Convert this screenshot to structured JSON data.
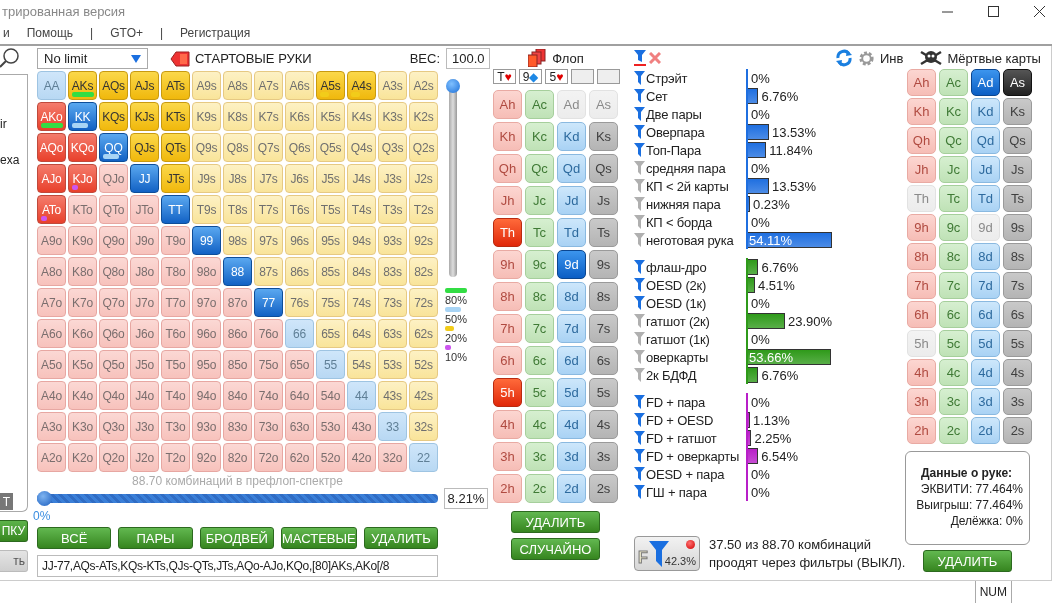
{
  "window": {
    "title": "трированная версия"
  },
  "menu": [
    "и",
    "Помощь",
    "|",
    "GTO+",
    "|",
    "Регистрация"
  ],
  "left_panel": {
    "texts": [
      "ir",
      "exa"
    ],
    "tag": "T",
    "buttons": [
      {
        "label": "ПКУ",
        "disabled": false
      },
      {
        "label": "ть",
        "disabled": true
      }
    ]
  },
  "range": {
    "game_type": "No limit",
    "title": "СТАРТОВЫЕ РУКИ",
    "weight_label": "ВЕС:",
    "weight_value": "100.0",
    "weight_slider": {
      "level": 1
    },
    "legend": [
      {
        "label": "80%",
        "color": "#33dd44"
      },
      {
        "label": "50%",
        "color": "#a8d4f5"
      },
      {
        "label": "20%",
        "color": "#f2cc1a"
      },
      {
        "label": "10%",
        "color": "#cc55ee"
      }
    ],
    "grid": [
      [
        {
          "label": "AA",
          "selected": false
        },
        {
          "label": "AKs",
          "selected": true,
          "color": "#33dd44"
        },
        {
          "label": "AQs",
          "selected": true
        },
        {
          "label": "AJs",
          "selected": true
        },
        {
          "label": "ATs",
          "selected": true
        },
        {
          "label": "A9s",
          "selected": false
        },
        {
          "label": "A8s",
          "selected": false
        },
        {
          "label": "A7s",
          "selected": false
        },
        {
          "label": "A6s",
          "selected": false
        },
        {
          "label": "A5s",
          "selected": true,
          "color": "#f2cc1a"
        },
        {
          "label": "A4s",
          "selected": true,
          "color": "#f2cc1a"
        },
        {
          "label": "A3s",
          "selected": false
        },
        {
          "label": "A2s",
          "selected": false
        }
      ],
      [
        {
          "label": "AKo",
          "selected": true,
          "color": "#33dd44"
        },
        {
          "label": "KK",
          "selected": true,
          "color": "#a8d4f5"
        },
        {
          "label": "KQs",
          "selected": true
        },
        {
          "label": "KJs",
          "selected": true
        },
        {
          "label": "KTs",
          "selected": true
        },
        {
          "label": "K9s",
          "selected": false
        },
        {
          "label": "K8s",
          "selected": false
        },
        {
          "label": "K7s",
          "selected": false
        },
        {
          "label": "K6s",
          "selected": false
        },
        {
          "label": "K5s",
          "selected": false
        },
        {
          "label": "K4s",
          "selected": false
        },
        {
          "label": "K3s",
          "selected": false
        },
        {
          "label": "K2s",
          "selected": false
        }
      ],
      [
        {
          "label": "AQo",
          "selected": true
        },
        {
          "label": "KQo",
          "selected": true
        },
        {
          "label": "QQ",
          "selected": true,
          "color": "#a8d4f5"
        },
        {
          "label": "QJs",
          "selected": true
        },
        {
          "label": "QTs",
          "selected": true
        },
        {
          "label": "Q9s",
          "selected": false
        },
        {
          "label": "Q8s",
          "selected": false
        },
        {
          "label": "Q7s",
          "selected": false
        },
        {
          "label": "Q6s",
          "selected": false
        },
        {
          "label": "Q5s",
          "selected": false
        },
        {
          "label": "Q4s",
          "selected": false
        },
        {
          "label": "Q3s",
          "selected": false
        },
        {
          "label": "Q2s",
          "selected": false
        }
      ],
      [
        {
          "label": "AJo",
          "selected": true
        },
        {
          "label": "KJo",
          "selected": true,
          "color": "#cc55ee"
        },
        {
          "label": "QJo",
          "selected": false
        },
        {
          "label": "JJ",
          "selected": true
        },
        {
          "label": "JTs",
          "selected": true
        },
        {
          "label": "J9s",
          "selected": false
        },
        {
          "label": "J8s",
          "selected": false
        },
        {
          "label": "J7s",
          "selected": false
        },
        {
          "label": "J6s",
          "selected": false
        },
        {
          "label": "J5s",
          "selected": false
        },
        {
          "label": "J4s",
          "selected": false
        },
        {
          "label": "J3s",
          "selected": false
        },
        {
          "label": "J2s",
          "selected": false
        }
      ],
      [
        {
          "label": "ATo",
          "selected": true,
          "color": "#cc55ee"
        },
        {
          "label": "KTo",
          "selected": false
        },
        {
          "label": "QTo",
          "selected": false
        },
        {
          "label": "JTo",
          "selected": false
        },
        {
          "label": "TT",
          "selected": true
        },
        {
          "label": "T9s",
          "selected": false
        },
        {
          "label": "T8s",
          "selected": false
        },
        {
          "label": "T7s",
          "selected": false
        },
        {
          "label": "T6s",
          "selected": false
        },
        {
          "label": "T5s",
          "selected": false
        },
        {
          "label": "T4s",
          "selected": false
        },
        {
          "label": "T3s",
          "selected": false
        },
        {
          "label": "T2s",
          "selected": false
        }
      ],
      [
        {
          "label": "A9o",
          "selected": false
        },
        {
          "label": "K9o",
          "selected": false
        },
        {
          "label": "Q9o",
          "selected": false
        },
        {
          "label": "J9o",
          "selected": false
        },
        {
          "label": "T9o",
          "selected": false
        },
        {
          "label": "99",
          "selected": true
        },
        {
          "label": "98s",
          "selected": false
        },
        {
          "label": "97s",
          "selected": false
        },
        {
          "label": "96s",
          "selected": false
        },
        {
          "label": "95s",
          "selected": false
        },
        {
          "label": "94s",
          "selected": false
        },
        {
          "label": "93s",
          "selected": false
        },
        {
          "label": "92s",
          "selected": false
        }
      ],
      [
        {
          "label": "A8o",
          "selected": false
        },
        {
          "label": "K8o",
          "selected": false
        },
        {
          "label": "Q8o",
          "selected": false
        },
        {
          "label": "J8o",
          "selected": false
        },
        {
          "label": "T8o",
          "selected": false
        },
        {
          "label": "98o",
          "selected": false
        },
        {
          "label": "88",
          "selected": true
        },
        {
          "label": "87s",
          "selected": false
        },
        {
          "label": "86s",
          "selected": false
        },
        {
          "label": "85s",
          "selected": false
        },
        {
          "label": "84s",
          "selected": false
        },
        {
          "label": "83s",
          "selected": false
        },
        {
          "label": "82s",
          "selected": false
        }
      ],
      [
        {
          "label": "A7o",
          "selected": false
        },
        {
          "label": "K7o",
          "selected": false
        },
        {
          "label": "Q7o",
          "selected": false
        },
        {
          "label": "J7o",
          "selected": false
        },
        {
          "label": "T7o",
          "selected": false
        },
        {
          "label": "97o",
          "selected": false
        },
        {
          "label": "87o",
          "selected": false
        },
        {
          "label": "77",
          "selected": true
        },
        {
          "label": "76s",
          "selected": false
        },
        {
          "label": "75s",
          "selected": false
        },
        {
          "label": "74s",
          "selected": false
        },
        {
          "label": "73s",
          "selected": false
        },
        {
          "label": "72s",
          "selected": false
        }
      ],
      [
        {
          "label": "A6o",
          "selected": false
        },
        {
          "label": "K6o",
          "selected": false
        },
        {
          "label": "Q6o",
          "selected": false
        },
        {
          "label": "J6o",
          "selected": false
        },
        {
          "label": "T6o",
          "selected": false
        },
        {
          "label": "96o",
          "selected": false
        },
        {
          "label": "86o",
          "selected": false
        },
        {
          "label": "76o",
          "selected": false
        },
        {
          "label": "66",
          "selected": false
        },
        {
          "label": "65s",
          "selected": false
        },
        {
          "label": "64s",
          "selected": false
        },
        {
          "label": "63s",
          "selected": false
        },
        {
          "label": "62s",
          "selected": false
        }
      ],
      [
        {
          "label": "A5o",
          "selected": false
        },
        {
          "label": "K5o",
          "selected": false
        },
        {
          "label": "Q5o",
          "selected": false
        },
        {
          "label": "J5o",
          "selected": false
        },
        {
          "label": "T5o",
          "selected": false
        },
        {
          "label": "95o",
          "selected": false
        },
        {
          "label": "85o",
          "selected": false
        },
        {
          "label": "75o",
          "selected": false
        },
        {
          "label": "65o",
          "selected": false
        },
        {
          "label": "55",
          "selected": false
        },
        {
          "label": "54s",
          "selected": false
        },
        {
          "label": "53s",
          "selected": false
        },
        {
          "label": "52s",
          "selected": false
        }
      ],
      [
        {
          "label": "A4o",
          "selected": false
        },
        {
          "label": "K4o",
          "selected": false
        },
        {
          "label": "Q4o",
          "selected": false
        },
        {
          "label": "J4o",
          "selected": false
        },
        {
          "label": "T4o",
          "selected": false
        },
        {
          "label": "94o",
          "selected": false
        },
        {
          "label": "84o",
          "selected": false
        },
        {
          "label": "74o",
          "selected": false
        },
        {
          "label": "64o",
          "selected": false
        },
        {
          "label": "54o",
          "selected": false
        },
        {
          "label": "44",
          "selected": false
        },
        {
          "label": "43s",
          "selected": false
        },
        {
          "label": "42s",
          "selected": false
        }
      ],
      [
        {
          "label": "A3o",
          "selected": false
        },
        {
          "label": "K3o",
          "selected": false
        },
        {
          "label": "Q3o",
          "selected": false
        },
        {
          "label": "J3o",
          "selected": false
        },
        {
          "label": "T3o",
          "selected": false
        },
        {
          "label": "93o",
          "selected": false
        },
        {
          "label": "83o",
          "selected": false
        },
        {
          "label": "73o",
          "selected": false
        },
        {
          "label": "63o",
          "selected": false
        },
        {
          "label": "53o",
          "selected": false
        },
        {
          "label": "43o",
          "selected": false
        },
        {
          "label": "33",
          "selected": false
        },
        {
          "label": "32s",
          "selected": false
        }
      ],
      [
        {
          "label": "A2o",
          "selected": false
        },
        {
          "label": "K2o",
          "selected": false
        },
        {
          "label": "Q2o",
          "selected": false
        },
        {
          "label": "J2o",
          "selected": false
        },
        {
          "label": "T2o",
          "selected": false
        },
        {
          "label": "92o",
          "selected": false
        },
        {
          "label": "82o",
          "selected": false
        },
        {
          "label": "72o",
          "selected": false
        },
        {
          "label": "62o",
          "selected": false
        },
        {
          "label": "52o",
          "selected": false
        },
        {
          "label": "42o",
          "selected": false
        },
        {
          "label": "32o",
          "selected": false
        },
        {
          "label": "22",
          "selected": false
        }
      ]
    ],
    "combos_text": "88.70 комбинаций в префлоп-спектре",
    "range_slider": {
      "level": 0
    },
    "min_label": "0%",
    "percent": "8.21%",
    "buttons": [
      "ВСЁ",
      "ПАРЫ",
      "БРОДВЕЙ",
      "МАСТЕВЫЕ",
      "УДАЛИТЬ"
    ],
    "range_text": "JJ-77,AQs-ATs,KQs-KTs,QJs-QTs,JTs,AQo-AJo,KQo,[80]AKs,AKo[/8"
  },
  "flop": {
    "title": "Флоп",
    "board": [
      {
        "kind": "card",
        "rank": "T",
        "suit": "♥",
        "color": "#e00000"
      },
      {
        "kind": "card",
        "rank": "9",
        "suit": "◆",
        "color": "#1e88e5"
      },
      {
        "kind": "card",
        "rank": "5",
        "suit": "♥",
        "color": "#e00000"
      },
      {
        "kind": "empty"
      },
      {
        "kind": "empty"
      }
    ],
    "deck": [
      [
        {
          "label": "Ah",
          "selected": false,
          "disabled": false
        },
        {
          "label": "Ac",
          "selected": false,
          "disabled": false
        },
        {
          "label": "Ad",
          "selected": false,
          "disabled": true
        },
        {
          "label": "As",
          "selected": false,
          "disabled": true
        }
      ],
      [
        {
          "label": "Kh",
          "selected": false,
          "disabled": false
        },
        {
          "label": "Kc",
          "selected": false,
          "disabled": false
        },
        {
          "label": "Kd",
          "selected": false,
          "disabled": false
        },
        {
          "label": "Ks",
          "selected": false,
          "disabled": false
        }
      ],
      [
        {
          "label": "Qh",
          "selected": false,
          "disabled": false
        },
        {
          "label": "Qc",
          "selected": false,
          "disabled": false
        },
        {
          "label": "Qd",
          "selected": false,
          "disabled": false
        },
        {
          "label": "Qs",
          "selected": false,
          "disabled": false
        }
      ],
      [
        {
          "label": "Jh",
          "selected": false,
          "disabled": false
        },
        {
          "label": "Jc",
          "selected": false,
          "disabled": false
        },
        {
          "label": "Jd",
          "selected": false,
          "disabled": false
        },
        {
          "label": "Js",
          "selected": false,
          "disabled": false
        }
      ],
      [
        {
          "label": "Th",
          "selected": true,
          "disabled": false
        },
        {
          "label": "Tc",
          "selected": false,
          "disabled": false
        },
        {
          "label": "Td",
          "selected": false,
          "disabled": false
        },
        {
          "label": "Ts",
          "selected": false,
          "disabled": false
        }
      ],
      [
        {
          "label": "9h",
          "selected": false,
          "disabled": false
        },
        {
          "label": "9c",
          "selected": false,
          "disabled": false
        },
        {
          "label": "9d",
          "selected": true,
          "disabled": false
        },
        {
          "label": "9s",
          "selected": false,
          "disabled": false
        }
      ],
      [
        {
          "label": "8h",
          "selected": false,
          "disabled": false
        },
        {
          "label": "8c",
          "selected": false,
          "disabled": false
        },
        {
          "label": "8d",
          "selected": false,
          "disabled": false
        },
        {
          "label": "8s",
          "selected": false,
          "disabled": false
        }
      ],
      [
        {
          "label": "7h",
          "selected": false,
          "disabled": false
        },
        {
          "label": "7c",
          "selected": false,
          "disabled": false
        },
        {
          "label": "7d",
          "selected": false,
          "disabled": false
        },
        {
          "label": "7s",
          "selected": false,
          "disabled": false
        }
      ],
      [
        {
          "label": "6h",
          "selected": false,
          "disabled": false
        },
        {
          "label": "6c",
          "selected": false,
          "disabled": false
        },
        {
          "label": "6d",
          "selected": false,
          "disabled": false
        },
        {
          "label": "6s",
          "selected": false,
          "disabled": false
        }
      ],
      [
        {
          "label": "5h",
          "selected": true,
          "disabled": false
        },
        {
          "label": "5c",
          "selected": false,
          "disabled": false
        },
        {
          "label": "5d",
          "selected": false,
          "disabled": false
        },
        {
          "label": "5s",
          "selected": false,
          "disabled": false
        }
      ],
      [
        {
          "label": "4h",
          "selected": false,
          "disabled": false
        },
        {
          "label": "4c",
          "selected": false,
          "disabled": false
        },
        {
          "label": "4d",
          "selected": false,
          "disabled": false
        },
        {
          "label": "4s",
          "selected": false,
          "disabled": false
        }
      ],
      [
        {
          "label": "3h",
          "selected": false,
          "disabled": false
        },
        {
          "label": "3c",
          "selected": false,
          "disabled": false
        },
        {
          "label": "3d",
          "selected": false,
          "disabled": false
        },
        {
          "label": "3s",
          "selected": false,
          "disabled": false
        }
      ],
      [
        {
          "label": "2h",
          "selected": false,
          "disabled": false
        },
        {
          "label": "2c",
          "selected": false,
          "disabled": false
        },
        {
          "label": "2d",
          "selected": false,
          "disabled": false
        },
        {
          "label": "2s",
          "selected": false,
          "disabled": false
        }
      ]
    ],
    "buttons": [
      "УДАЛИТЬ",
      "СЛУЧАЙНО"
    ]
  },
  "stats": {
    "groups": [
      {
        "color": "#1f6fe0",
        "rows": [
          {
            "label": "Стрэйт",
            "active": true,
            "value": "0%"
          },
          {
            "label": "Сет",
            "active": true,
            "value": "6.76%",
            "level": 0.0676
          },
          {
            "label": "Две пары",
            "active": true,
            "value": "0%"
          },
          {
            "label": "Оверпара",
            "active": true,
            "value": "13.53%",
            "level": 0.1353
          },
          {
            "label": "Топ-Пара",
            "active": true,
            "value": "11.84%",
            "level": 0.1184
          },
          {
            "label": "средняя пара",
            "active": false,
            "value": "0%"
          },
          {
            "label": "КП < 2й карты",
            "active": false,
            "value": "13.53%",
            "level": 0.1353
          },
          {
            "label": "нижняя пара",
            "active": false,
            "value": "0.23%",
            "level": 0.0023
          },
          {
            "label": "КП < борда",
            "active": false,
            "value": "0%"
          },
          {
            "label": "неготовая рука",
            "active": false,
            "value": "54.11%",
            "level": 0.5411
          }
        ]
      },
      {
        "color": "#2f9a1a",
        "rows": [
          {
            "label": "флаш-дро",
            "active": true,
            "value": "6.76%",
            "level": 0.0676
          },
          {
            "label": "OESD (2к)",
            "active": true,
            "value": "4.51%",
            "level": 0.0451
          },
          {
            "label": "OESD (1к)",
            "active": true,
            "value": "0%"
          },
          {
            "label": "гатшот (2к)",
            "active": false,
            "value": "23.90%",
            "level": 0.239
          },
          {
            "label": "гатшот (1к)",
            "active": false,
            "value": "0%"
          },
          {
            "label": "оверкарты",
            "active": false,
            "value": "53.66%",
            "level": 0.5366
          },
          {
            "label": "2к БДФД",
            "active": false,
            "value": "6.76%",
            "level": 0.0676
          }
        ]
      },
      {
        "color": "#b81fc8",
        "rows": [
          {
            "label": "FD + пара",
            "active": true,
            "value": "0%"
          },
          {
            "label": "FD + OESD",
            "active": true,
            "value": "1.13%",
            "level": 0.0113
          },
          {
            "label": "FD + гатшот",
            "active": true,
            "value": "2.25%",
            "level": 0.0225
          },
          {
            "label": "FD + оверкарты",
            "active": true,
            "value": "6.54%",
            "level": 0.0654
          },
          {
            "label": "OESD + пара",
            "active": true,
            "value": "0%"
          },
          {
            "label": "ГШ + пара",
            "active": true,
            "value": "0%"
          }
        ]
      }
    ],
    "filter_button": {
      "letter": "F",
      "percent": "42.3%",
      "alert": true
    },
    "summary": [
      "37.50 из 88.70 комбинаций",
      "проодят через фильтры (ВЫКЛ)."
    ]
  },
  "dead": {
    "invert_label": "Инв",
    "title": "Мёртвые карты",
    "deck": [
      [
        {
          "label": "Ah",
          "selected": false,
          "disabled": false
        },
        {
          "label": "Ac",
          "selected": false,
          "disabled": false
        },
        {
          "label": "Ad",
          "selected": true,
          "disabled": false
        },
        {
          "label": "As",
          "selected": true,
          "disabled": false
        }
      ],
      [
        {
          "label": "Kh",
          "selected": false,
          "disabled": false
        },
        {
          "label": "Kc",
          "selected": false,
          "disabled": false
        },
        {
          "label": "Kd",
          "selected": false,
          "disabled": false
        },
        {
          "label": "Ks",
          "selected": false,
          "disabled": false
        }
      ],
      [
        {
          "label": "Qh",
          "selected": false,
          "disabled": false
        },
        {
          "label": "Qc",
          "selected": false,
          "disabled": false
        },
        {
          "label": "Qd",
          "selected": false,
          "disabled": false
        },
        {
          "label": "Qs",
          "selected": false,
          "disabled": false
        }
      ],
      [
        {
          "label": "Jh",
          "selected": false,
          "disabled": false
        },
        {
          "label": "Jc",
          "selected": false,
          "disabled": false
        },
        {
          "label": "Jd",
          "selected": false,
          "disabled": false
        },
        {
          "label": "Js",
          "selected": false,
          "disabled": false
        }
      ],
      [
        {
          "label": "Th",
          "selected": false,
          "disabled": true
        },
        {
          "label": "Tc",
          "selected": false,
          "disabled": false
        },
        {
          "label": "Td",
          "selected": false,
          "disabled": false
        },
        {
          "label": "Ts",
          "selected": false,
          "disabled": false
        }
      ],
      [
        {
          "label": "9h",
          "selected": false,
          "disabled": false
        },
        {
          "label": "9c",
          "selected": false,
          "disabled": false
        },
        {
          "label": "9d",
          "selected": false,
          "disabled": true
        },
        {
          "label": "9s",
          "selected": false,
          "disabled": false
        }
      ],
      [
        {
          "label": "8h",
          "selected": false,
          "disabled": false
        },
        {
          "label": "8c",
          "selected": false,
          "disabled": false
        },
        {
          "label": "8d",
          "selected": false,
          "disabled": false
        },
        {
          "label": "8s",
          "selected": false,
          "disabled": false
        }
      ],
      [
        {
          "label": "7h",
          "selected": false,
          "disabled": false
        },
        {
          "label": "7c",
          "selected": false,
          "disabled": false
        },
        {
          "label": "7d",
          "selected": false,
          "disabled": false
        },
        {
          "label": "7s",
          "selected": false,
          "disabled": false
        }
      ],
      [
        {
          "label": "6h",
          "selected": false,
          "disabled": false
        },
        {
          "label": "6c",
          "selected": false,
          "disabled": false
        },
        {
          "label": "6d",
          "selected": false,
          "disabled": false
        },
        {
          "label": "6s",
          "selected": false,
          "disabled": false
        }
      ],
      [
        {
          "label": "5h",
          "selected": false,
          "disabled": true
        },
        {
          "label": "5c",
          "selected": false,
          "disabled": false
        },
        {
          "label": "5d",
          "selected": false,
          "disabled": false
        },
        {
          "label": "5s",
          "selected": false,
          "disabled": false
        }
      ],
      [
        {
          "label": "4h",
          "selected": false,
          "disabled": false
        },
        {
          "label": "4c",
          "selected": false,
          "disabled": false
        },
        {
          "label": "4d",
          "selected": false,
          "disabled": false
        },
        {
          "label": "4s",
          "selected": false,
          "disabled": false
        }
      ],
      [
        {
          "label": "3h",
          "selected": false,
          "disabled": false
        },
        {
          "label": "3c",
          "selected": false,
          "disabled": false
        },
        {
          "label": "3d",
          "selected": false,
          "disabled": false
        },
        {
          "label": "3s",
          "selected": false,
          "disabled": false
        }
      ],
      [
        {
          "label": "2h",
          "selected": false,
          "disabled": false
        },
        {
          "label": "2c",
          "selected": false,
          "disabled": false
        },
        {
          "label": "2d",
          "selected": false,
          "disabled": false
        },
        {
          "label": "2s",
          "selected": false,
          "disabled": false
        }
      ]
    ],
    "hand_info": {
      "title": "Данные о руке:",
      "lines": [
        "ЭКВИТИ: 77.464%",
        "Выигрыш: 77.464%",
        "Делёжка: 0%"
      ]
    },
    "clear_button": "УДАЛИТЬ"
  },
  "status_bar": {
    "indicators": [
      "NUM"
    ]
  }
}
